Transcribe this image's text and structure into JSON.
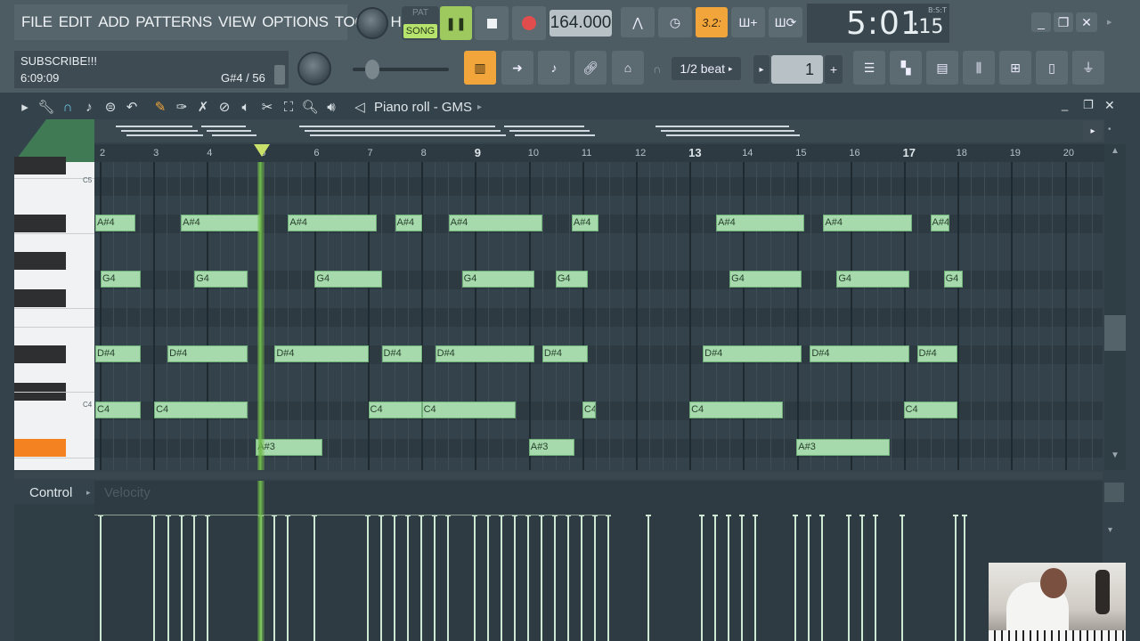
{
  "menu": [
    "FILE",
    "EDIT",
    "ADD",
    "PATTERNS",
    "VIEW",
    "OPTIONS",
    "TOOLS",
    "HELP"
  ],
  "transport": {
    "pat_label": "PAT",
    "song_label": "SONG",
    "tempo": "164.000",
    "time_main": "5:01",
    "time_sub": ":15",
    "time_label": "B:S:T",
    "snap_label": "1/2 beat",
    "step_value": "1",
    "mode_32": "3.2:"
  },
  "hint": {
    "line1": "SUBSCRIBE!!!",
    "line2": "6:09:09",
    "note_info": "G#4 / 56"
  },
  "piano_roll": {
    "title": "Piano roll - GMS",
    "key_labels": [
      "C5",
      "C4"
    ]
  },
  "ruler": [
    "2",
    "3",
    "4",
    "5",
    "6",
    "7",
    "8",
    "9",
    "10",
    "11",
    "12",
    "13",
    "14",
    "15",
    "16",
    "17",
    "18",
    "19",
    "20"
  ],
  "notes": [
    {
      "label": "A#4",
      "row": "as4",
      "start": 1.0,
      "len": 0.75
    },
    {
      "label": "A#4",
      "row": "as4",
      "start": 2.6,
      "len": 1.5
    },
    {
      "label": "A#4",
      "row": "as4",
      "start": 4.6,
      "len": 1.65
    },
    {
      "label": "A#4",
      "row": "as4",
      "start": 6.6,
      "len": 0.5
    },
    {
      "label": "A#4",
      "row": "as4",
      "start": 7.6,
      "len": 1.75
    },
    {
      "label": "A#4",
      "row": "as4",
      "start": 9.9,
      "len": 0.5
    },
    {
      "label": "A#4",
      "row": "as4",
      "start": 12.6,
      "len": 1.65
    },
    {
      "label": "A#4",
      "row": "as4",
      "start": 14.6,
      "len": 1.65
    },
    {
      "label": "A#4",
      "row": "as4",
      "start": 16.6,
      "len": 0.35
    },
    {
      "label": "G4",
      "row": "g4",
      "start": 1.1,
      "len": 0.75
    },
    {
      "label": "G4",
      "row": "g4",
      "start": 2.85,
      "len": 1.0
    },
    {
      "label": "G4",
      "row": "g4",
      "start": 5.1,
      "len": 1.25
    },
    {
      "label": "G4",
      "row": "g4",
      "start": 7.85,
      "len": 1.35
    },
    {
      "label": "G4",
      "row": "g4",
      "start": 9.6,
      "len": 0.6
    },
    {
      "label": "G4",
      "row": "g4",
      "start": 12.85,
      "len": 1.35
    },
    {
      "label": "G4",
      "row": "g4",
      "start": 14.85,
      "len": 1.35
    },
    {
      "label": "G4",
      "row": "g4",
      "start": 16.85,
      "len": 0.35
    },
    {
      "label": "D#4",
      "row": "ds4",
      "start": 1.0,
      "len": 0.85
    },
    {
      "label": "D#4",
      "row": "ds4",
      "start": 2.35,
      "len": 1.5
    },
    {
      "label": "D#4",
      "row": "ds4",
      "start": 4.35,
      "len": 1.75
    },
    {
      "label": "D#4",
      "row": "ds4",
      "start": 6.35,
      "len": 0.75
    },
    {
      "label": "D#4",
      "row": "ds4",
      "start": 7.35,
      "len": 1.85
    },
    {
      "label": "D#4",
      "row": "ds4",
      "start": 9.35,
      "len": 0.85
    },
    {
      "label": "D#4",
      "row": "ds4",
      "start": 12.35,
      "len": 1.85
    },
    {
      "label": "D#4",
      "row": "ds4",
      "start": 14.35,
      "len": 1.85
    },
    {
      "label": "D#4",
      "row": "ds4",
      "start": 16.35,
      "len": 0.75
    },
    {
      "label": "C4",
      "row": "c4",
      "start": 1.0,
      "len": 0.85
    },
    {
      "label": "C4",
      "row": "c4",
      "start": 2.1,
      "len": 1.75
    },
    {
      "label": "C4",
      "row": "c4",
      "start": 6.1,
      "len": 1.0
    },
    {
      "label": "C4",
      "row": "c4",
      "start": 7.1,
      "len": 1.75
    },
    {
      "label": "C4",
      "row": "c4",
      "start": 10.1,
      "len": 0.25
    },
    {
      "label": "C4",
      "row": "c4",
      "start": 12.1,
      "len": 1.75
    },
    {
      "label": "C4",
      "row": "c4",
      "start": 16.1,
      "len": 1.0
    },
    {
      "label": "A#3",
      "row": "as3",
      "start": 4.0,
      "len": 1.25
    },
    {
      "label": "A#3",
      "row": "as3",
      "start": 9.1,
      "len": 0.85
    },
    {
      "label": "A#3",
      "row": "as3",
      "start": 14.1,
      "len": 1.75
    }
  ],
  "control": {
    "label": "Control",
    "param": "Velocity"
  }
}
